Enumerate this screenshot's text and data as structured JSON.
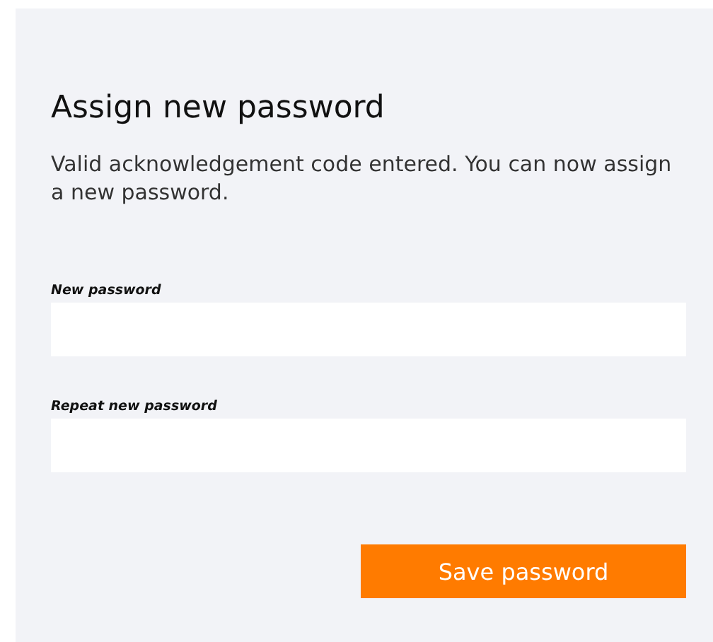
{
  "title": "Assign new password",
  "message": "Valid acknowledgement code entered. You can now assign a new password.",
  "fields": [
    {
      "label": "New password"
    },
    {
      "label": "Repeat new password"
    }
  ],
  "button": "Save password"
}
